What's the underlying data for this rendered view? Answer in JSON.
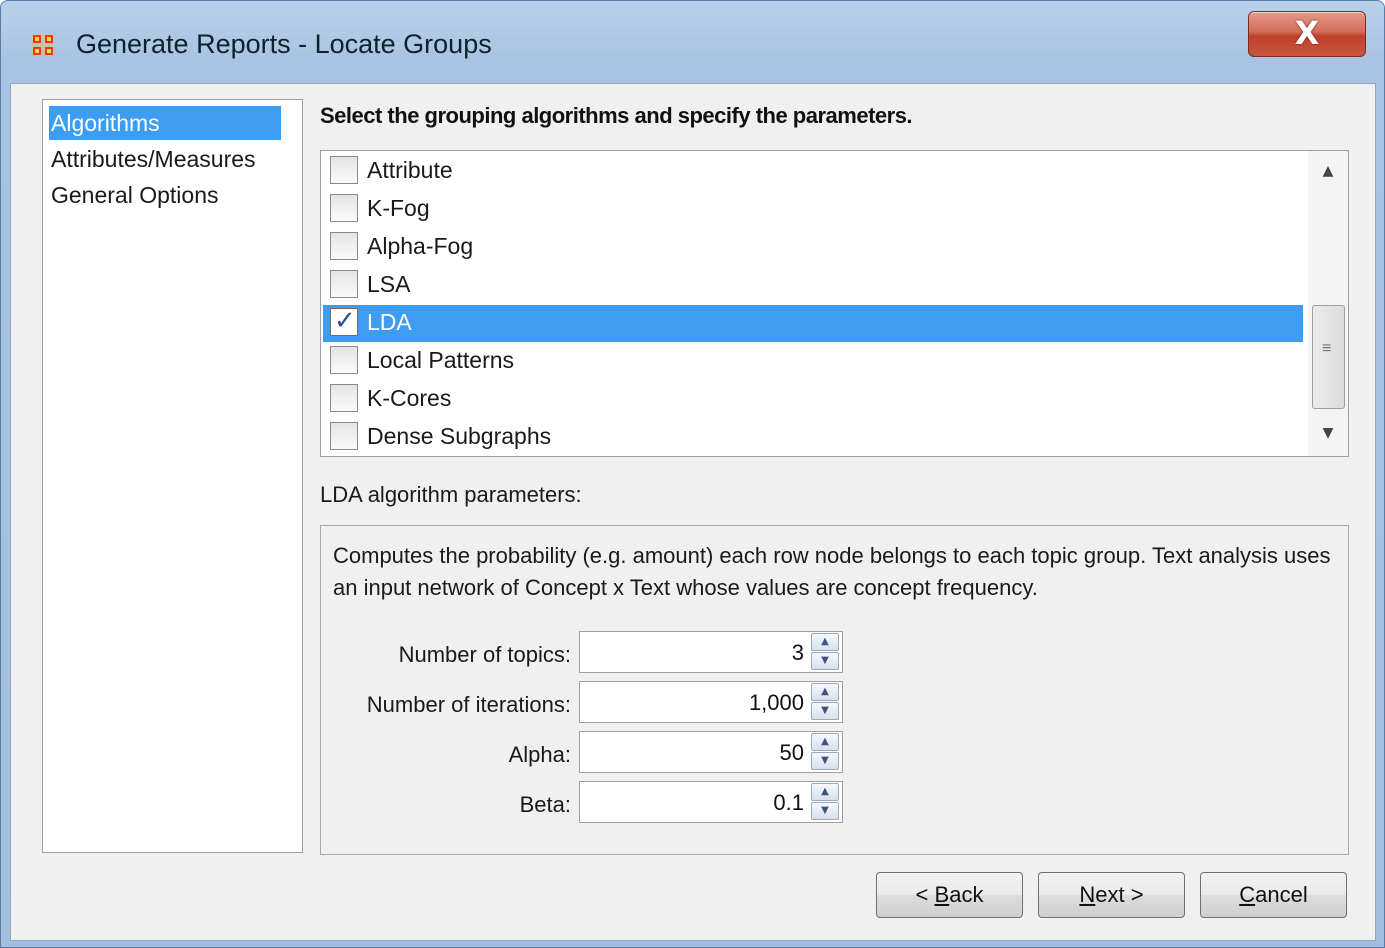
{
  "window": {
    "title": "Generate Reports - Locate Groups",
    "close_glyph": "X",
    "app_icon": "network-grid-icon"
  },
  "sidebar": {
    "items": [
      {
        "label": "Algorithms",
        "selected": true
      },
      {
        "label": "Attributes/Measures",
        "selected": false
      },
      {
        "label": "General Options",
        "selected": false
      }
    ]
  },
  "main": {
    "heading": "Select the grouping algorithms and specify the parameters.",
    "algorithms": [
      {
        "label": "Attribute",
        "checked": false,
        "selected": false
      },
      {
        "label": "K-Fog",
        "checked": false,
        "selected": false
      },
      {
        "label": "Alpha-Fog",
        "checked": false,
        "selected": false
      },
      {
        "label": "LSA",
        "checked": false,
        "selected": false
      },
      {
        "label": "LDA",
        "checked": true,
        "selected": true
      },
      {
        "label": "Local Patterns",
        "checked": false,
        "selected": false
      },
      {
        "label": "K-Cores",
        "checked": false,
        "selected": false
      },
      {
        "label": "Dense Subgraphs",
        "checked": false,
        "selected": false
      }
    ],
    "params_title": "LDA algorithm parameters:",
    "description": "Computes the probability (e.g. amount) each row node belongs to each topic group. Text analysis uses an input network of Concept x Text whose values are concept frequency.",
    "fields": [
      {
        "label": "Number of topics:",
        "value": "3"
      },
      {
        "label": "Number of iterations:",
        "value": "1,000"
      },
      {
        "label": "Alpha:",
        "value": "50"
      },
      {
        "label": "Beta:",
        "value": "0.1"
      }
    ]
  },
  "buttons": {
    "back": {
      "mnemonic": "B",
      "pre": "< ",
      "rest": "ack"
    },
    "next": {
      "mnemonic": "N",
      "pre": "",
      "rest": "ext >"
    },
    "cancel": {
      "mnemonic": "C",
      "pre": "",
      "rest": "ancel"
    }
  },
  "colors": {
    "selection": "#3d9df2",
    "close_button": "#c9553d",
    "title_bar": "#b9d1ea"
  }
}
